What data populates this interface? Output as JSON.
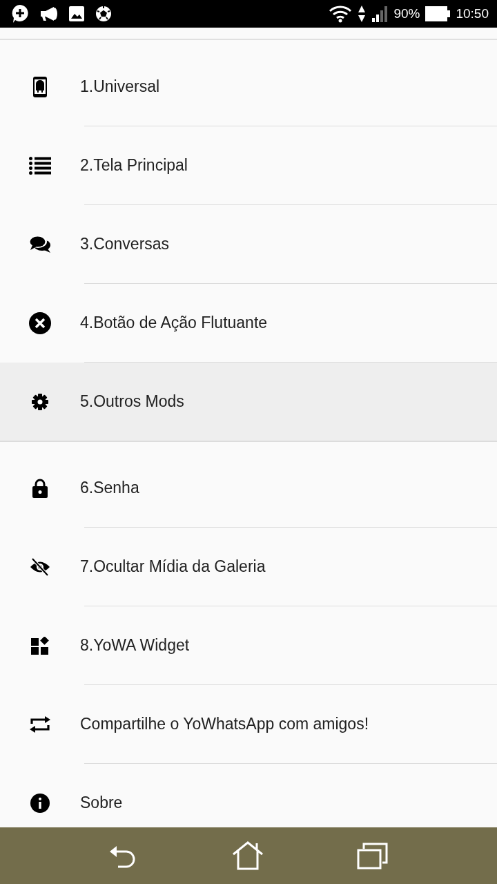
{
  "status_bar": {
    "battery": "90%",
    "time": "10:50"
  },
  "menu_groups": [
    {
      "items": [
        {
          "label": "1.Universal",
          "selected": false
        },
        {
          "label": "2.Tela Principal",
          "selected": false
        },
        {
          "label": "3.Conversas",
          "selected": false
        },
        {
          "label": "4.Botão de Ação Flutuante",
          "selected": false
        },
        {
          "label": "5.Outros Mods",
          "selected": true
        }
      ]
    },
    {
      "items": [
        {
          "label": "6.Senha",
          "selected": false
        },
        {
          "label": "7.Ocultar Mídia da Galeria",
          "selected": false
        },
        {
          "label": "8.YoWA Widget",
          "selected": false
        },
        {
          "label": "Compartilhe o YoWhatsApp com amigos!",
          "selected": false
        },
        {
          "label": "Sobre",
          "selected": false
        }
      ]
    }
  ]
}
